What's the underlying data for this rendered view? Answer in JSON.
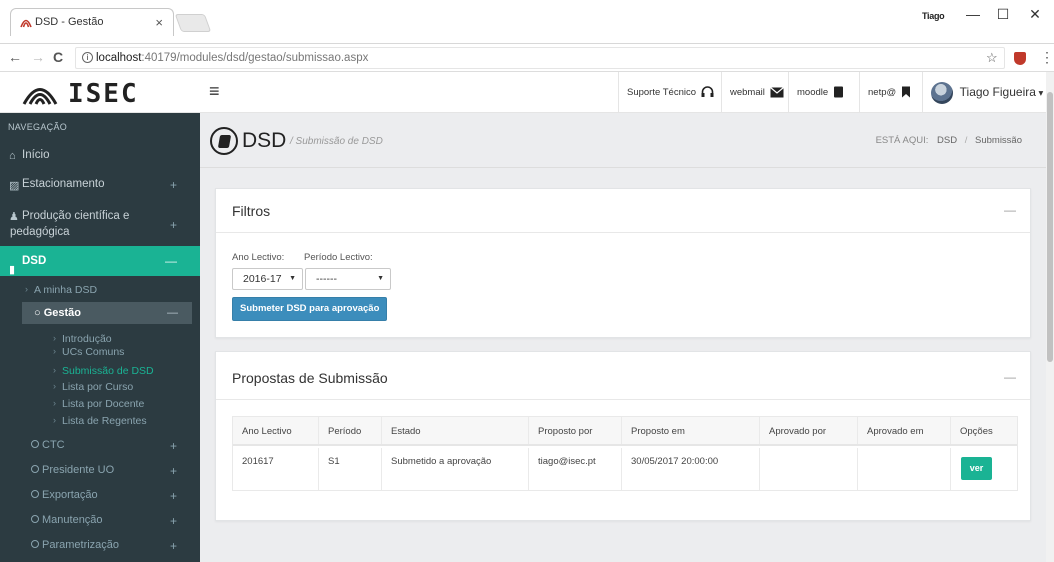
{
  "browser": {
    "tab_title": "DSD - Gestão",
    "tab_close": "×",
    "window_user": "Tiago",
    "url_host": "localhost",
    "url_path": ":40179/modules/dsd/gestao/submissao.aspx",
    "buttons": {
      "back": "←",
      "forward": "→",
      "reload": "C",
      "minimize": "—",
      "maximize": "☐",
      "close": "✕"
    },
    "star_icon": "☆",
    "menu_icon": "⋮"
  },
  "app": {
    "brand": "ISEC",
    "hamburger": "≡",
    "topnav": {
      "support": "Suporte Técnico",
      "webmail": "webmail",
      "moodle": "moodle",
      "netpa": "netp@",
      "user": "Tiago Figueira",
      "user_caret": "▾"
    }
  },
  "sidebar": {
    "header": "NAVEGAÇÃO",
    "items": [
      {
        "label": "Início",
        "icon": "home-icon"
      },
      {
        "label": "Estacionamento",
        "icon": "car-icon",
        "toggle": "+"
      },
      {
        "label": "Produção científica e",
        "label2": "pedagógica",
        "icon": "user-icon",
        "toggle": "+"
      },
      {
        "label": "DSD",
        "icon": "book-icon",
        "toggle": "—"
      }
    ],
    "dsd_sub": [
      {
        "label": "A minha DSD"
      },
      {
        "label": "Gestão",
        "toggle": "—"
      }
    ],
    "gestao_sub": [
      {
        "label": "Introdução"
      },
      {
        "label": "UCs Comuns"
      },
      {
        "label": "Submissão de DSD"
      },
      {
        "label": "Lista por Curso"
      },
      {
        "label": "Lista por Docente"
      },
      {
        "label": "Lista de Regentes"
      }
    ],
    "more": [
      {
        "label": "CTC",
        "toggle": "+"
      },
      {
        "label": "Presidente UO",
        "toggle": "+"
      },
      {
        "label": "Exportação",
        "toggle": "+"
      },
      {
        "label": "Manutenção",
        "toggle": "+"
      },
      {
        "label": "Parametrização",
        "toggle": "+"
      }
    ],
    "chevron": "›"
  },
  "page": {
    "title": "DSD",
    "subtitle": "/ Submissão de DSD",
    "breadcrumb_label": "ESTÁ AQUI:",
    "breadcrumb": [
      "DSD",
      "Submissão"
    ],
    "breadcrumb_sep": "/"
  },
  "filters": {
    "title": "Filtros",
    "collapse": "—",
    "ano_label": "Ano Lectivo:",
    "ano_value": "2016-17",
    "periodo_label": "Período Lectivo:",
    "periodo_value": "------",
    "caret": "▼",
    "submit_label": "Submeter DSD para aprovação"
  },
  "proposals": {
    "title": "Propostas de Submissão",
    "collapse": "—",
    "columns": [
      "Ano Lectivo",
      "Período",
      "Estado",
      "Proposto por",
      "Proposto em",
      "Aprovado por",
      "Aprovado em",
      "Opções"
    ],
    "rows": [
      {
        "ano": "201617",
        "periodo": "S1",
        "estado": "Submetido a aprovação",
        "proposto_por": "tiago@isec.pt",
        "proposto_em": "30/05/2017 20:00:00",
        "aprovado_por": "",
        "aprovado_em": "",
        "opcao": "ver"
      }
    ]
  },
  "colors": {
    "accent": "#1ab394",
    "sidebar_bg": "#2c3b41",
    "primary_button": "#3c8dbc"
  }
}
